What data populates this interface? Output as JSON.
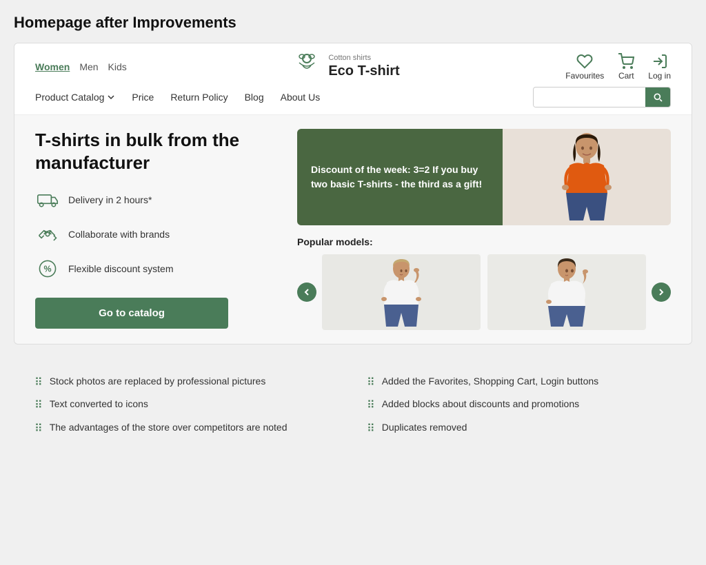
{
  "page": {
    "title": "Homepage after Improvements"
  },
  "header": {
    "gender_nav": {
      "items": [
        {
          "label": "Women",
          "active": true
        },
        {
          "label": "Men",
          "active": false
        },
        {
          "label": "Kids",
          "active": false
        }
      ]
    },
    "logo": {
      "sub": "Cotton shirts",
      "main": "Eco T-shirt"
    },
    "actions": [
      {
        "label": "Favourites",
        "icon": "heart-icon"
      },
      {
        "label": "Cart",
        "icon": "cart-icon"
      },
      {
        "label": "Log in",
        "icon": "login-icon"
      }
    ],
    "nav": {
      "items": [
        {
          "label": "Product Catalog",
          "has_dropdown": true
        },
        {
          "label": "Price",
          "has_dropdown": false
        },
        {
          "label": "Return Policy",
          "has_dropdown": false
        },
        {
          "label": "Blog",
          "has_dropdown": false
        },
        {
          "label": "About Us",
          "has_dropdown": false
        }
      ]
    },
    "search": {
      "placeholder": ""
    }
  },
  "hero": {
    "title": "T-shirts in bulk from the manufacturer",
    "features": [
      {
        "text": "Delivery in 2 hours*",
        "icon": "truck-icon"
      },
      {
        "text": "Collaborate with brands",
        "icon": "handshake-icon"
      },
      {
        "text": "Flexible discount system",
        "icon": "discount-icon"
      }
    ],
    "cta_label": "Go to catalog",
    "promo": {
      "text": "Discount of the week: 3=2 If you buy two basic T-shirts - the third as a gift!"
    },
    "popular_label": "Popular models:",
    "carousel": {
      "prev_label": "‹",
      "next_label": "›"
    }
  },
  "improvements": {
    "left": [
      "Stock photos are replaced by professional pictures",
      "Text converted to icons",
      "The advantages of the store over competitors are noted"
    ],
    "right": [
      "Added the Favorites, Shopping Cart, Login buttons",
      "Added blocks about discounts and promotions",
      "Duplicates removed"
    ]
  }
}
